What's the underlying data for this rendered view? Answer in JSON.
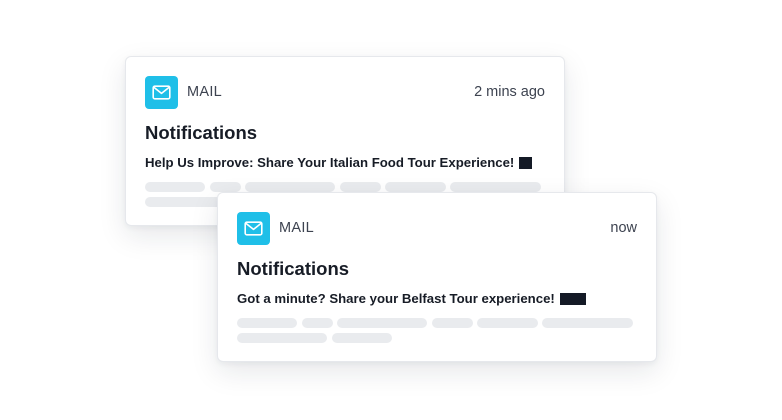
{
  "colors": {
    "accent": "#1fbfe8",
    "skeleton": "#e9ebee",
    "redaction": "#141a26"
  },
  "notifications": [
    {
      "app_icon": "mail-icon",
      "app_name": "MAIL",
      "time": "2 mins ago",
      "title": "Notifications",
      "message": "Help Us Improve: Share Your Italian Food Tour Experience!"
    },
    {
      "app_icon": "mail-icon",
      "app_name": "MAIL",
      "time": "now",
      "title": "Notifications",
      "message": "Got a minute? Share your Belfast Tour experience!"
    }
  ]
}
